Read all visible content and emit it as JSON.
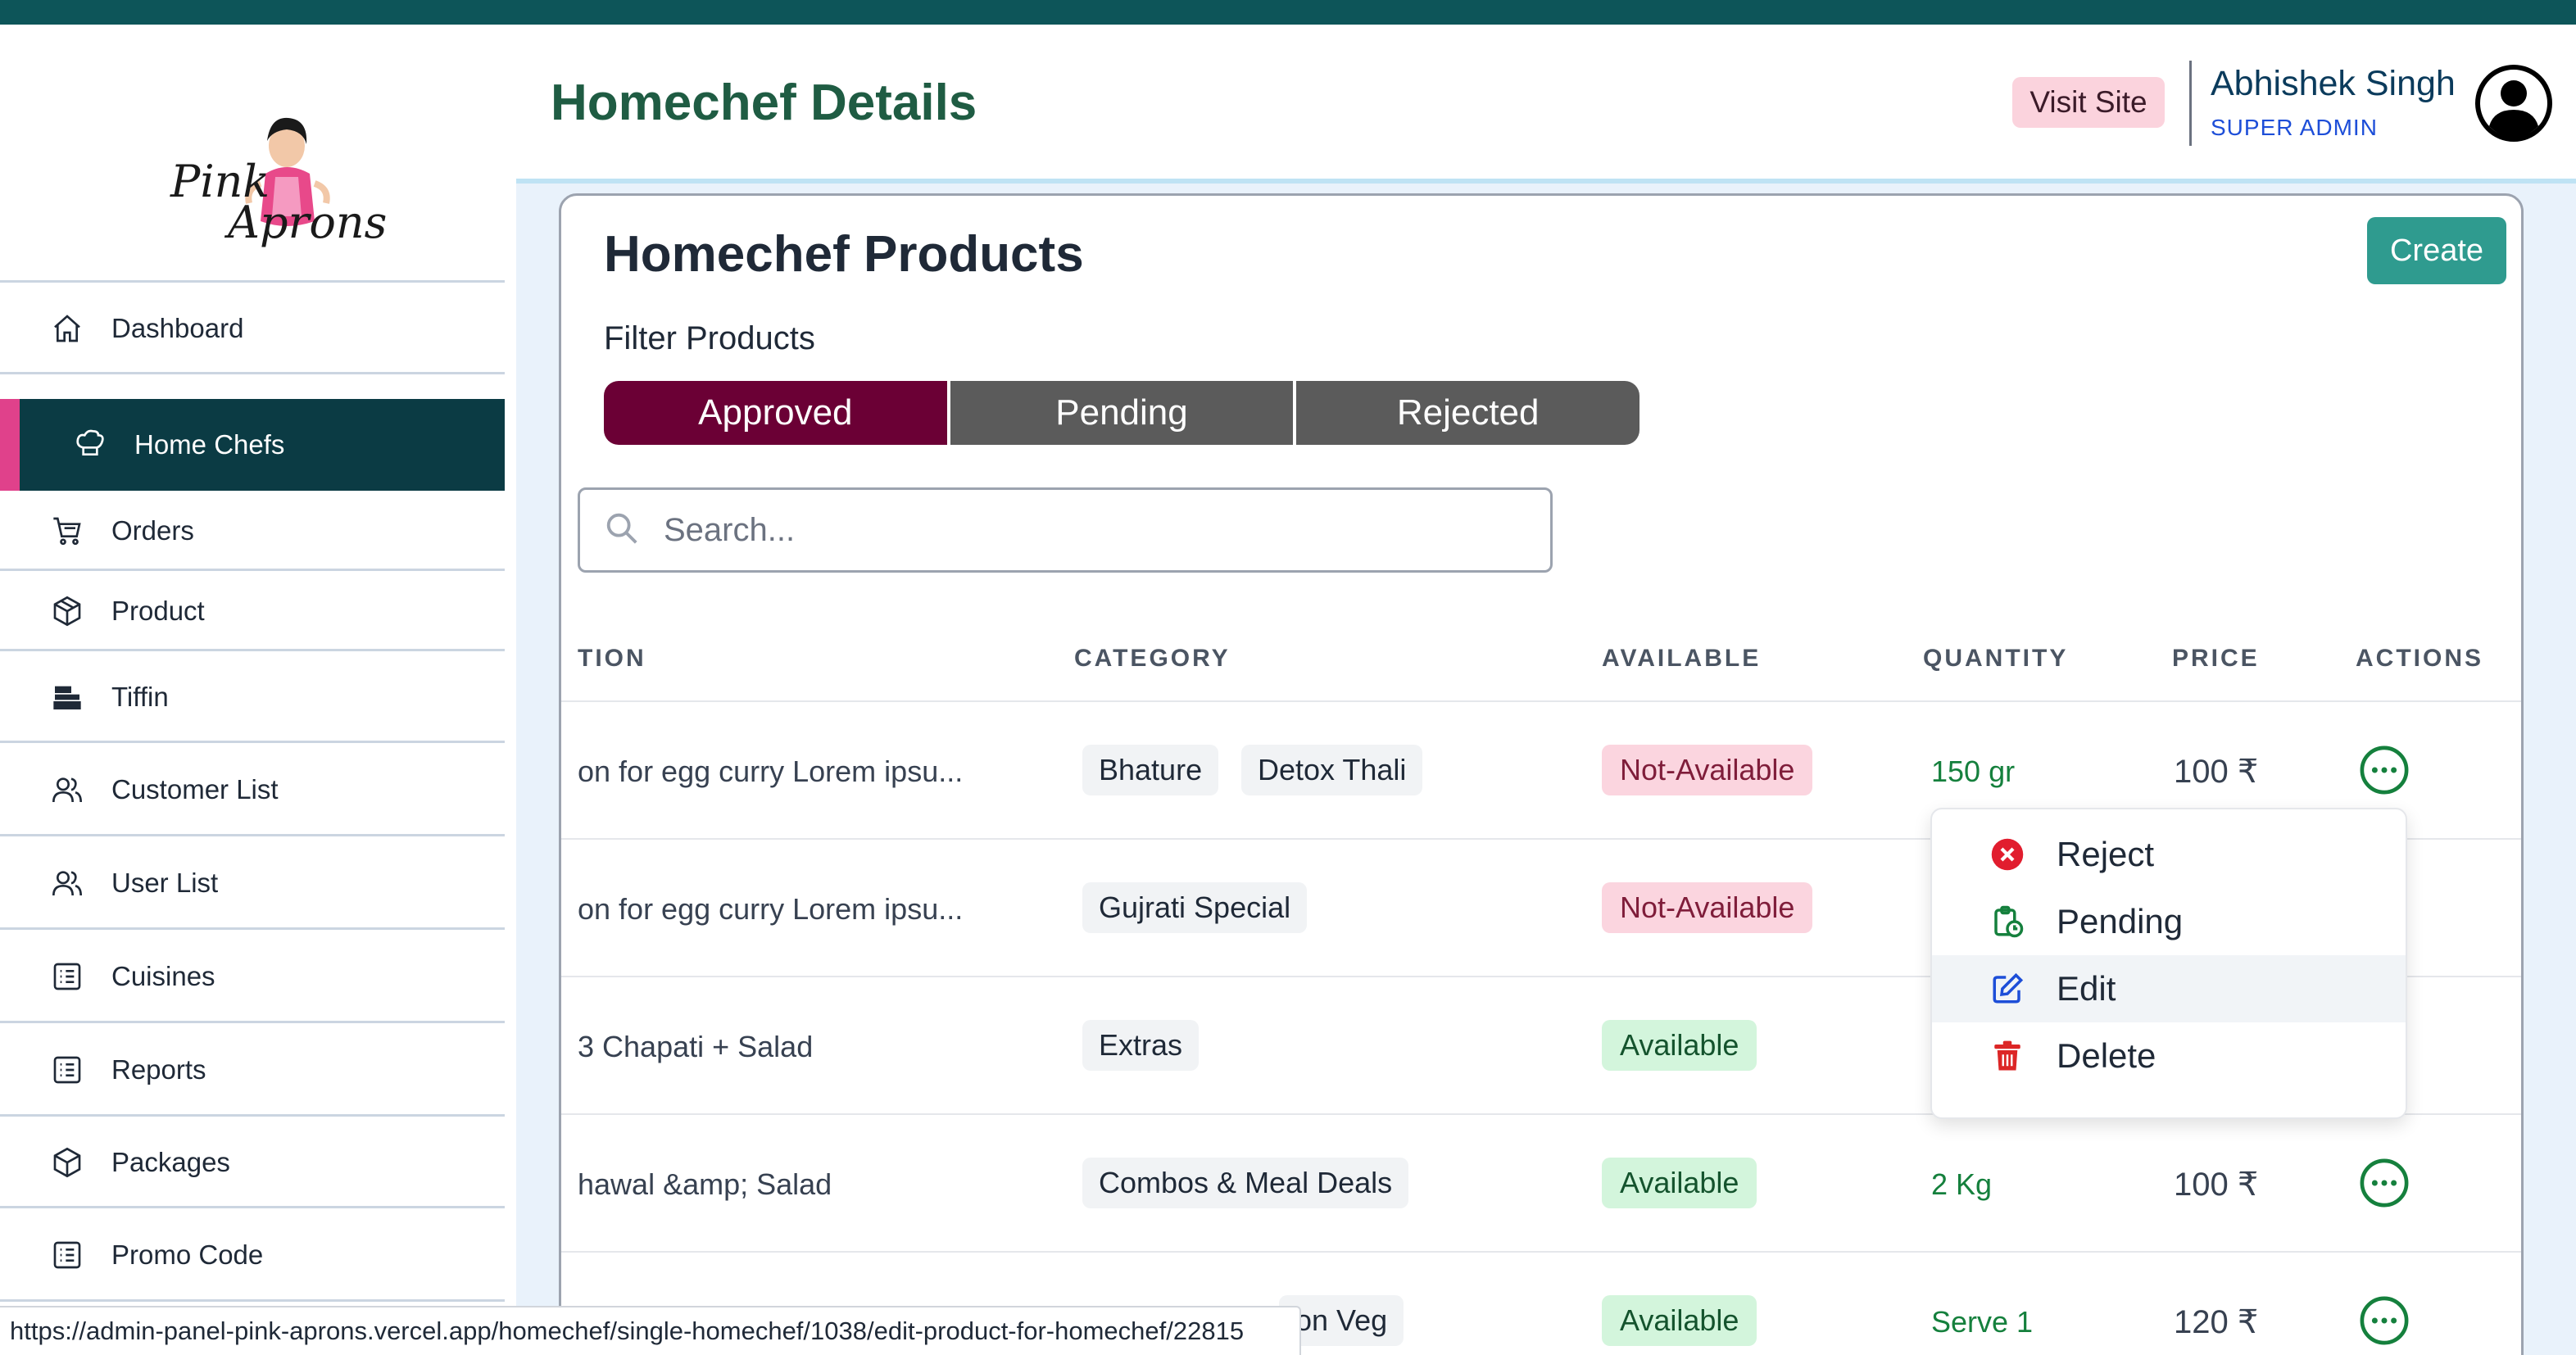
{
  "app": {
    "logo_line1": "Pink",
    "logo_line2": "Aprons",
    "page_title": "Homechef Details",
    "visit_site_label": "Visit Site",
    "user_name": "Abhishek Singh",
    "user_role": "SUPER ADMIN"
  },
  "sidebar": {
    "items": [
      {
        "label": "Dashboard",
        "icon": "home-icon"
      },
      {
        "label": "Home Chefs",
        "icon": "chef-hat-icon",
        "active": true
      },
      {
        "label": "Orders",
        "icon": "cart-icon"
      },
      {
        "label": "Product",
        "icon": "box-icon"
      },
      {
        "label": "Tiffin",
        "icon": "tiffin-icon"
      },
      {
        "label": "Customer List",
        "icon": "users-icon"
      },
      {
        "label": "User List",
        "icon": "users-icon"
      },
      {
        "label": "Cuisines",
        "icon": "list-icon"
      },
      {
        "label": "Reports",
        "icon": "list-icon"
      },
      {
        "label": "Packages",
        "icon": "package-icon"
      },
      {
        "label": "Promo Code",
        "icon": "list-icon"
      }
    ]
  },
  "main": {
    "card_title": "Homechef Products",
    "create_label": "Create",
    "filter_label": "Filter Products",
    "filters": [
      {
        "label": "Approved",
        "active": true
      },
      {
        "label": "Pending",
        "active": false
      },
      {
        "label": "Rejected",
        "active": false
      }
    ],
    "search_placeholder": "Search..."
  },
  "table": {
    "headers": [
      "TION",
      "CATEGORY",
      "AVAILABLE",
      "QUANTITY",
      "PRICE",
      "ACTIONS"
    ],
    "rows": [
      {
        "description": "on for egg curry Lorem ipsu...",
        "categories": [
          "Bhature",
          "Detox Thali"
        ],
        "available": "Not-Available",
        "quantity": "150 gr",
        "price": "100 ₹"
      },
      {
        "description": "on for egg curry Lorem ipsu...",
        "categories": [
          "Gujrati Special"
        ],
        "available": "Not-Available",
        "quantity": "",
        "price": ""
      },
      {
        "description": " 3 Chapati + Salad",
        "categories": [
          "Extras"
        ],
        "available": "Available",
        "quantity": "",
        "price": ""
      },
      {
        "description": "hawal &amp; Salad",
        "categories": [
          "Combos & Meal Deals"
        ],
        "available": "Available",
        "quantity": "2 Kg",
        "price": "100 ₹"
      },
      {
        "description": "",
        "categories": [
          "on Veg"
        ],
        "available": "Available",
        "quantity": "Serve 1",
        "price": "120 ₹"
      }
    ]
  },
  "action_menu": {
    "items": [
      {
        "label": "Reject",
        "icon": "x-circle-icon"
      },
      {
        "label": "Pending",
        "icon": "clipboard-clock-icon"
      },
      {
        "label": "Edit",
        "icon": "edit-icon",
        "hovered": true
      },
      {
        "label": "Delete",
        "icon": "trash-icon"
      }
    ]
  },
  "status_bar": {
    "url": "https://admin-panel-pink-aprons.vercel.app/homechef/single-homechef/1038/edit-product-for-homechef/22815"
  },
  "colors": {
    "sidebar_active_bg": "#0b3b44",
    "sidebar_active_accent": "#e0418b",
    "title_green": "#1f5c43",
    "filter_active": "#6b0035",
    "filter_inactive": "#5b5b5b",
    "create_button": "#2f9b8f",
    "available_bg": "#d3f5dc",
    "not_available_bg": "#fbd5df",
    "quantity_green": "#15803d"
  }
}
